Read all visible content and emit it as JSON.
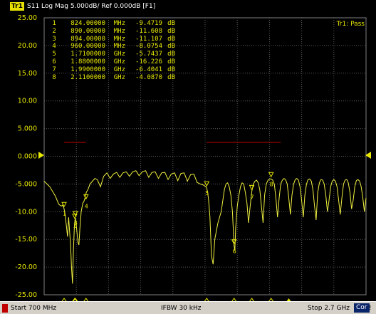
{
  "header": {
    "trace_badge": "Tr1",
    "trace_title": "S11 Log Mag 5.000dB/ Ref 0.000dB [F1]",
    "limit_result": "Tr1: Pass"
  },
  "axis": {
    "y_ticks": [
      "25.00",
      "20.00",
      "15.00",
      "10.00",
      "5.000",
      "0.000",
      "-5.000",
      "-10.00",
      "-15.00",
      "-20.00",
      "-25.00"
    ]
  },
  "markers": [
    {
      "num": "1",
      "freq": "824.00000",
      "unit": "MHz",
      "value": "-9.4719",
      "db": "dB"
    },
    {
      "num": "2",
      "freq": "890.00000",
      "unit": "MHz",
      "value": "-11.608",
      "db": "dB"
    },
    {
      "num": "3",
      "freq": "894.00000",
      "unit": "MHz",
      "value": "-11.107",
      "db": "dB"
    },
    {
      "num": "4",
      "freq": "960.00000",
      "unit": "MHz",
      "value": "-8.0754",
      "db": "dB"
    },
    {
      "num": "5",
      "freq": "1.7100000",
      "unit": "GHz",
      "value": "-5.7437",
      "db": "dB"
    },
    {
      "num": "6",
      "freq": "1.8800000",
      "unit": "GHz",
      "value": "-16.226",
      "db": "dB"
    },
    {
      "num": "7",
      "freq": "1.9900000",
      "unit": "GHz",
      "value": "-6.4041",
      "db": "dB"
    },
    {
      "num": "8",
      "freq": "2.1100000",
      "unit": "GHz",
      "value": "-4.0870",
      "db": "dB"
    }
  ],
  "status": {
    "start": "Start 700 MHz",
    "ifbw": "IFBW 30 kHz",
    "stop": "Stop 2.7 GHz",
    "cor": "Cor",
    "excl": "!"
  },
  "chart_data": {
    "type": "line",
    "xlim_mhz": [
      700,
      2700
    ],
    "ylim_db": [
      -25,
      25
    ],
    "ref_level_db": 0,
    "grid": true,
    "limit_lines": [
      {
        "x_mhz": [
          824,
          960
        ],
        "y_db": 2.5
      },
      {
        "x_mhz": [
          1710,
          2170
        ],
        "y_db": 2.5
      }
    ],
    "series": [
      {
        "x_mhz": [
          700,
          735,
          770,
          790,
          805,
          815,
          824,
          830,
          838,
          845,
          852,
          858,
          864,
          870,
          876,
          882,
          888,
          891,
          894,
          900,
          905,
          910,
          916,
          922,
          930,
          940,
          948,
          953,
          958,
          962,
          972,
          985,
          1000,
          1015,
          1030,
          1050,
          1070,
          1090,
          1110,
          1130,
          1150,
          1170,
          1190,
          1210,
          1230,
          1250,
          1270,
          1290,
          1310,
          1330,
          1350,
          1370,
          1390,
          1410,
          1430,
          1450,
          1470,
          1490,
          1510,
          1530,
          1550,
          1570,
          1590,
          1610,
          1630,
          1650,
          1670,
          1690,
          1705,
          1710,
          1716,
          1722,
          1730,
          1740,
          1750,
          1760,
          1770,
          1780,
          1790,
          1800,
          1810,
          1820,
          1830,
          1840,
          1850,
          1860,
          1870,
          1880,
          1885,
          1890,
          1900,
          1910,
          1920,
          1930,
          1940,
          1950,
          1960,
          1970,
          1980,
          1990,
          2000,
          2010,
          2020,
          2030,
          2040,
          2050,
          2060,
          2070,
          2080,
          2090,
          2100,
          2110,
          2120,
          2130,
          2140,
          2150,
          2160,
          2170,
          2180,
          2190,
          2200,
          2210,
          2220,
          2230,
          2240,
          2250,
          2260,
          2270,
          2280,
          2290,
          2300,
          2310,
          2320,
          2330,
          2340,
          2350,
          2360,
          2370,
          2380,
          2390,
          2400,
          2410,
          2420,
          2430,
          2440,
          2450,
          2460,
          2470,
          2480,
          2490,
          2500,
          2510,
          2520,
          2530,
          2540,
          2550,
          2560,
          2570,
          2580,
          2590,
          2600,
          2610,
          2620,
          2630,
          2640,
          2650,
          2660,
          2670,
          2680,
          2690,
          2700
        ],
        "y_db": [
          -4.5,
          -5.5,
          -7.2,
          -8.6,
          -9.0,
          -8.8,
          -9.47,
          -10.5,
          -12.5,
          -14.5,
          -11.0,
          -13.5,
          -16.0,
          -20.0,
          -23.0,
          -17.0,
          -12.5,
          -11.6,
          -11.1,
          -12.5,
          -14.0,
          -15.5,
          -16.0,
          -13.0,
          -10.0,
          -8.5,
          -8.1,
          -7.6,
          -7.0,
          -6.5,
          -6.0,
          -5.0,
          -4.5,
          -4.0,
          -4.2,
          -5.5,
          -3.6,
          -3.0,
          -4.0,
          -3.2,
          -2.9,
          -3.8,
          -3.0,
          -2.8,
          -3.6,
          -2.8,
          -2.6,
          -3.5,
          -2.8,
          -2.6,
          -3.8,
          -2.9,
          -2.8,
          -4.0,
          -3.0,
          -2.9,
          -4.2,
          -3.2,
          -3.0,
          -4.4,
          -3.1,
          -3.0,
          -4.5,
          -3.3,
          -3.2,
          -4.7,
          -5.0,
          -5.2,
          -5.5,
          -5.74,
          -6.5,
          -8.0,
          -11.0,
          -18.0,
          -19.5,
          -15.0,
          -13.5,
          -12.0,
          -11.0,
          -10.0,
          -8.0,
          -6.0,
          -5.0,
          -4.8,
          -5.5,
          -7.0,
          -10.0,
          -16.2,
          -17.0,
          -13.0,
          -9.0,
          -7.0,
          -5.5,
          -4.8,
          -5.0,
          -6.5,
          -8.5,
          -12.0,
          -9.0,
          -6.4,
          -5.0,
          -4.5,
          -4.3,
          -4.8,
          -6.0,
          -9.0,
          -12.0,
          -7.0,
          -5.0,
          -4.4,
          -4.1,
          -4.09,
          -4.3,
          -5.0,
          -7.5,
          -11.0,
          -7.5,
          -5.0,
          -4.3,
          -4.0,
          -4.2,
          -5.0,
          -7.5,
          -10.5,
          -7.0,
          -5.0,
          -4.2,
          -4.0,
          -4.3,
          -5.5,
          -8.0,
          -11.0,
          -7.0,
          -5.0,
          -4.2,
          -4.1,
          -4.5,
          -6.0,
          -9.0,
          -11.5,
          -6.5,
          -4.8,
          -4.2,
          -4.3,
          -5.0,
          -7.0,
          -10.0,
          -8.0,
          -5.5,
          -4.5,
          -4.2,
          -4.5,
          -5.5,
          -8.0,
          -10.5,
          -7.5,
          -5.0,
          -4.3,
          -4.2,
          -4.8,
          -6.5,
          -9.5,
          -8.0,
          -5.5,
          -4.4,
          -4.2,
          -4.5,
          -5.5,
          -7.5,
          -10.0,
          -7.5,
          -5.0,
          -4.3,
          -4.0,
          -4.2,
          -4.5,
          -4.3
        ]
      }
    ]
  }
}
